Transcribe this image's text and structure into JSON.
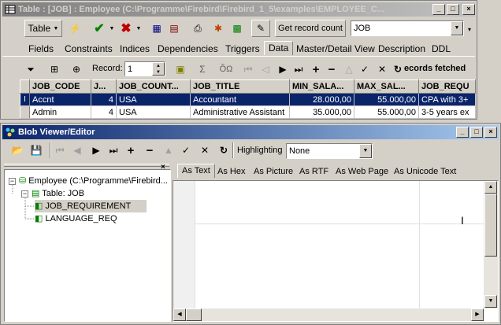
{
  "table_window": {
    "title": "Table : [JOB] : Employee (C:\\Programme\\Firebird\\Firebird_1_5\\examples\\EMPLOYEE_C...",
    "toolbar": {
      "table_menu": "Table",
      "get_record_count": "Get record count",
      "table_name": "JOB"
    },
    "tabs": [
      "Fields",
      "Constraints",
      "Indices",
      "Dependencies",
      "Triggers",
      "Data",
      "Master/Detail View",
      "Description",
      "DDL"
    ],
    "active_tab": "Data",
    "nav": {
      "record_label": "Record:",
      "record_value": "1",
      "status": "ecords fetched"
    },
    "grid": {
      "columns": [
        "JOB_CODE",
        "J...",
        "JOB_COUNT...",
        "JOB_TITLE",
        "MIN_SALA...",
        "MAX_SAL...",
        "JOB_REQU"
      ],
      "rows": [
        {
          "indicator": "I",
          "cells": [
            "Accnt",
            "4",
            "USA",
            "Accountant",
            "28.000,00",
            "55.000,00",
            "CPA with 3+"
          ]
        },
        {
          "indicator": "",
          "cells": [
            "Admin",
            "4",
            "USA",
            "Administrative Assistant",
            "35.000,00",
            "55.000,00",
            "3-5 years ex"
          ]
        }
      ]
    }
  },
  "blob_window": {
    "title": "Blob Viewer/Editor",
    "highlighting_label": "Highlighting",
    "highlighting_value": "None",
    "tree": {
      "root": "Employee (C:\\Programme\\Firebird...",
      "table": "Table: JOB",
      "fields": [
        "JOB_REQUIREMENT",
        "LANGUAGE_REQ"
      ]
    },
    "view_tabs": [
      "As Text",
      "As Hex",
      "As Picture",
      "As RTF",
      "As Web Page",
      "As Unicode Text"
    ],
    "active_view_tab": "As Text"
  },
  "colors": {
    "selection": "#0a246a",
    "face": "#d4d0c8"
  }
}
